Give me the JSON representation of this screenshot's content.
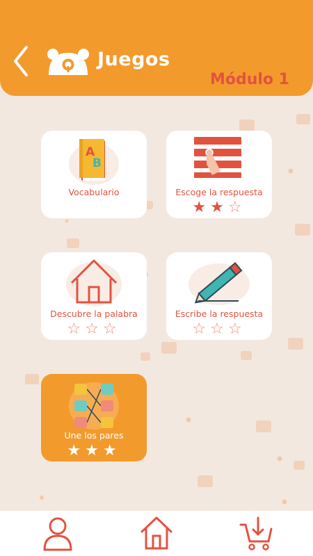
{
  "header": {
    "title": "Juegos",
    "module": "Módulo 1",
    "back_icon": "chevron-left-icon",
    "logo_icon": "bear-logo-icon"
  },
  "games": [
    {
      "label": "Vocabulario",
      "icon": "book-icon",
      "stars": ""
    },
    {
      "label": "Escoge la respuesta",
      "icon": "list-tap-icon",
      "stars_filled": 2,
      "stars_total": 3
    },
    {
      "label": "Descubre la palabra",
      "icon": "house-icon",
      "stars_filled": 0,
      "stars_total": 3
    },
    {
      "label": "Escribe la respuesta",
      "icon": "pencil-icon",
      "stars_filled": 0,
      "stars_total": 3
    },
    {
      "label": "Une los pares",
      "icon": "match-pairs-icon",
      "stars_filled": 3,
      "stars_total": 3
    }
  ],
  "bottom_nav": [
    {
      "name": "profile",
      "icon": "user-icon"
    },
    {
      "name": "home",
      "icon": "home-icon"
    },
    {
      "name": "downloads",
      "icon": "cart-download-icon"
    }
  ],
  "colors": {
    "accent": "#f39a2d",
    "primary_red": "#e2533f",
    "background": "#f3e8e0"
  }
}
